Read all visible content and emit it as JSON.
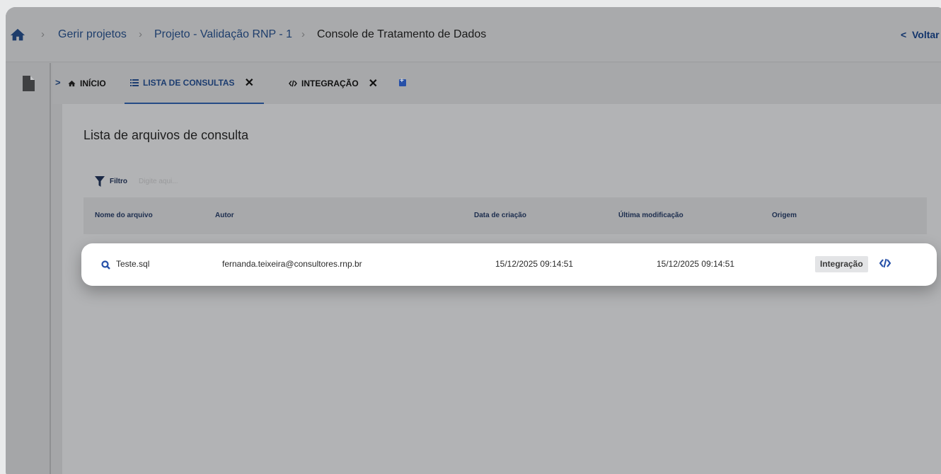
{
  "breadcrumb": {
    "items": [
      "Gerir projetos",
      "Projeto - Validação RNP - 1",
      "Console de Tratamento de Dados"
    ],
    "back_label": "Voltar"
  },
  "tabs": [
    {
      "label": "INÍCIO",
      "icon": "home-icon",
      "closable": false,
      "active": false
    },
    {
      "label": "LISTA DE CONSULTAS",
      "icon": "list-icon",
      "closable": true,
      "active": true
    },
    {
      "label": "INTEGRAÇÃO",
      "icon": "code-icon",
      "closable": true,
      "active": false
    }
  ],
  "tab_close_glyph": "✕",
  "page": {
    "title": "Lista de arquivos de consulta",
    "filter_label": "Filtro",
    "filter_placeholder": "Digite aqui..."
  },
  "table": {
    "columns": [
      "Nome do arquivo",
      "Autor",
      "Data de criação",
      "Última modificação",
      "Origem"
    ],
    "rows": [
      {
        "name": "Teste.sql",
        "author": "fernanda.teixeira@consultores.rnp.br",
        "created": "15/12/2025 09:14:51",
        "modified": "15/12/2025 09:14:51",
        "origin": "Integração"
      }
    ]
  },
  "colors": {
    "brand": "#1d3d70",
    "accent": "#2650a8"
  }
}
